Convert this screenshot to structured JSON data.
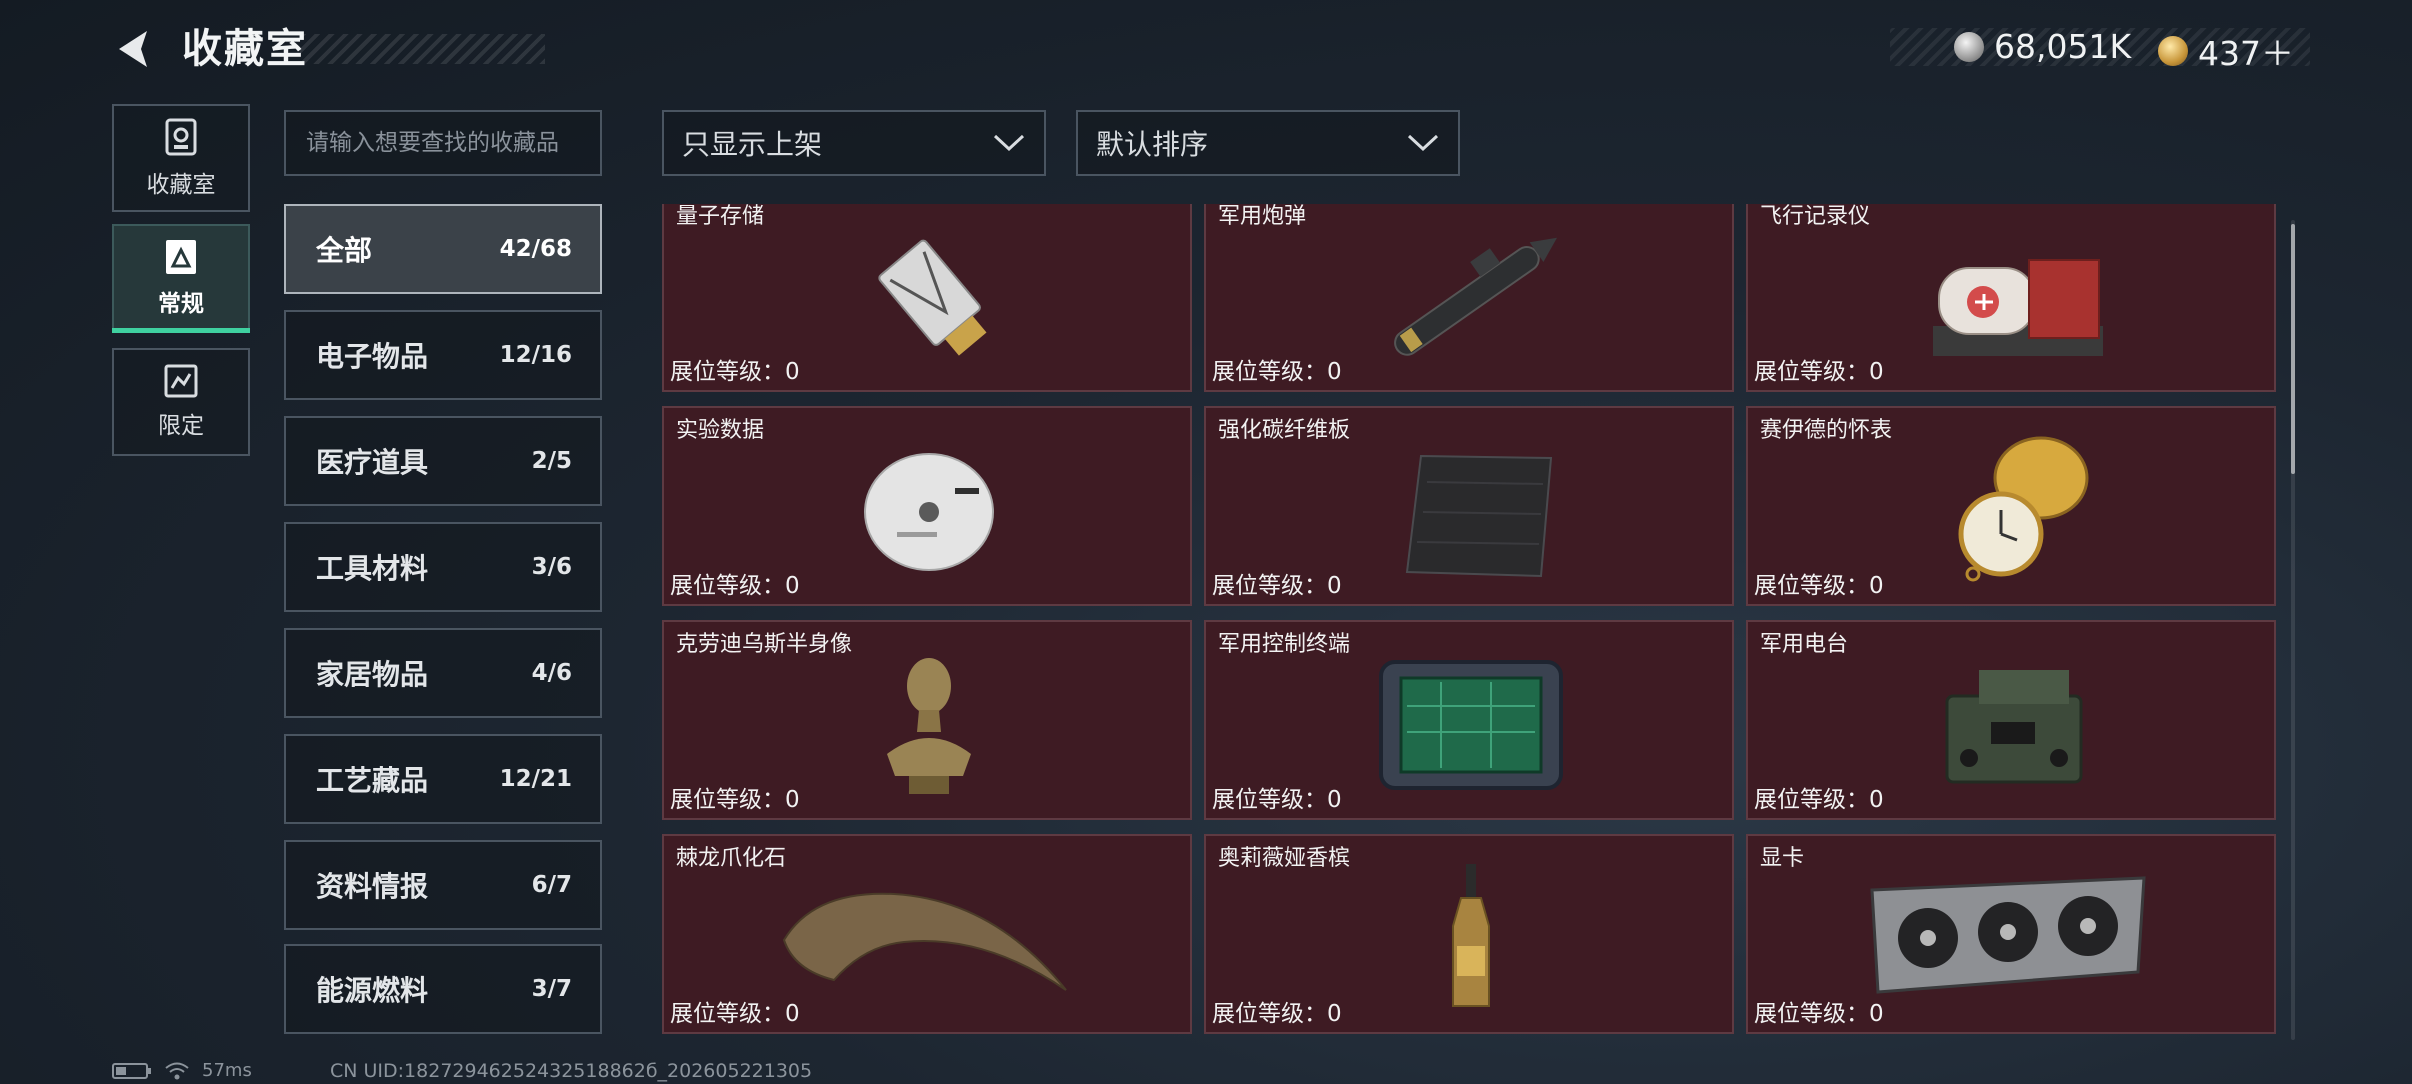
{
  "header": {
    "title": "收藏室",
    "currencies": [
      {
        "icon": "silver-coin-icon",
        "value": "68,051K"
      },
      {
        "icon": "gold-coin-icon",
        "value": "437＋"
      }
    ]
  },
  "modes": [
    {
      "label": "收藏室",
      "icon": "collection-room-icon",
      "active": false
    },
    {
      "label": "常规",
      "icon": "regular-card-icon",
      "active": true
    },
    {
      "label": "限定",
      "icon": "limited-card-icon",
      "active": false
    }
  ],
  "search": {
    "placeholder": "请输入想要查找的收藏品"
  },
  "filters": {
    "display_filter": "只显示上架",
    "sort": "默认排序"
  },
  "categories": [
    {
      "name": "全部",
      "count": "42/68",
      "active": true
    },
    {
      "name": "电子物品",
      "count": "12/16"
    },
    {
      "name": "医疗道具",
      "count": "2/5"
    },
    {
      "name": "工具材料",
      "count": "3/6"
    },
    {
      "name": "家居物品",
      "count": "4/6"
    },
    {
      "name": "工艺藏品",
      "count": "12/21"
    },
    {
      "name": "资料情报",
      "count": "6/7"
    },
    {
      "name": "能源燃料",
      "count": "3/7"
    }
  ],
  "level_label": "展位等级：0",
  "items": [
    {
      "name": "量子存储",
      "icon": "usb-drive-icon"
    },
    {
      "name": "军用炮弹",
      "icon": "artillery-shell-icon"
    },
    {
      "name": "飞行记录仪",
      "icon": "flight-recorder-icon"
    },
    {
      "name": "实验数据",
      "icon": "data-disc-icon"
    },
    {
      "name": "强化碳纤维板",
      "icon": "carbon-plate-icon"
    },
    {
      "name": "赛伊德的怀表",
      "icon": "pocket-watch-icon"
    },
    {
      "name": "克劳迪乌斯半身像",
      "icon": "bust-statue-icon"
    },
    {
      "name": "军用控制终端",
      "icon": "control-terminal-icon"
    },
    {
      "name": "军用电台",
      "icon": "military-radio-icon"
    },
    {
      "name": "棘龙爪化石",
      "icon": "claw-fossil-icon"
    },
    {
      "name": "奥莉薇娅香槟",
      "icon": "champagne-bottle-icon"
    },
    {
      "name": "显卡",
      "icon": "graphics-card-icon"
    }
  ],
  "footer": {
    "latency": "57ms",
    "uid": "CN UID:18272946252432518862б_202605221305"
  },
  "colors": {
    "accent": "#3fd1a0",
    "card_bg": "#3e1b23"
  }
}
